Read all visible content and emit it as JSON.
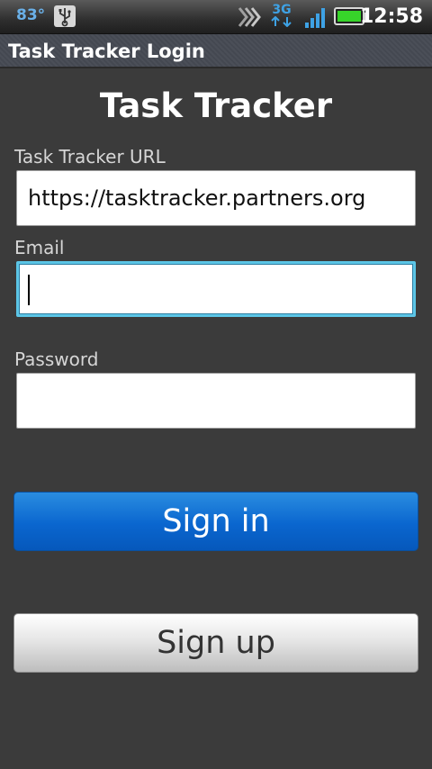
{
  "status_bar": {
    "temperature": "83°",
    "network_type": "3G",
    "time": "12:58",
    "icons": [
      "usb-icon",
      "wifi-icon",
      "3g-network-icon",
      "signal-strength-icon",
      "battery-icon"
    ],
    "accent_color": "#3ea2e5",
    "battery_color": "#37d42a"
  },
  "title_bar": {
    "title": "Task Tracker Login"
  },
  "form": {
    "heading": "Task Tracker",
    "url_label": "Task Tracker URL",
    "url_value": "https://tasktracker.partners.org",
    "email_label": "Email",
    "email_value": "",
    "password_label": "Password",
    "password_value": ""
  },
  "buttons": {
    "sign_in_label": "Sign in",
    "sign_up_label": "Sign up",
    "sign_in_color": "#0a66cf"
  }
}
